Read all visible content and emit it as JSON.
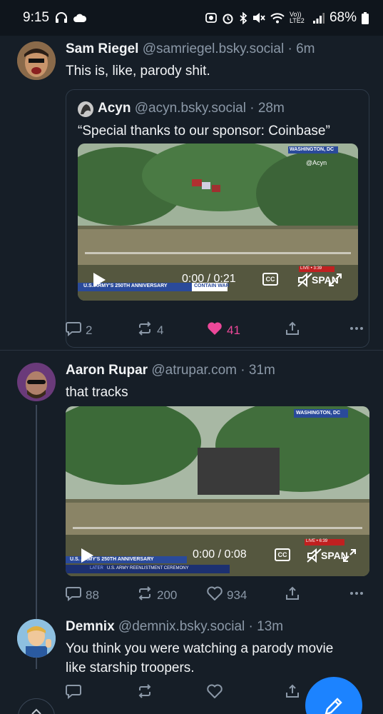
{
  "status_bar": {
    "time": "9:15",
    "network": "Vo)) LTE2",
    "battery": "68%"
  },
  "posts": [
    {
      "name": "Sam Riegel",
      "handle": "@samriegel.bsky.social",
      "time": "6m",
      "text": "This is, like, parody shit.",
      "quote": {
        "name": "Acyn",
        "handle": "@acyn.bsky.social",
        "time": "28m",
        "text": "“Special thanks to our sponsor: Coinbase”",
        "video": {
          "time": "0:00 / 0:21",
          "cc": "CC",
          "chyron": "U.S. ARMY'S 250TH ANNIVERSARY",
          "chyron_sub": "CONTAIN WAR",
          "location": "WASHINGTON, DC",
          "watermark": "@Acyn",
          "network": "SPAN",
          "live": "LIVE • 3:39"
        }
      },
      "replies": "2",
      "reposts": "4",
      "likes": "41"
    },
    {
      "name": "Aaron Rupar",
      "handle": "@atrupar.com",
      "time": "31m",
      "text": "that tracks",
      "video": {
        "time": "0:00 / 0:08",
        "cc": "CC",
        "chyron": "U.S. ARMY'S 250TH ANNIVERSARY",
        "chyron_later": "LATER",
        "chyron_sub": "U.S. ARMY REENLISTMENT CEREMONY",
        "location": "WASHINGTON, DC",
        "network": "SPAN",
        "live": "LIVE • 6:39"
      },
      "replies": "88",
      "reposts": "200",
      "likes": "934"
    },
    {
      "name": "Demnix",
      "handle": "@demnix.bsky.social",
      "time": "13m",
      "text_line1": "You think you were watching a parody movie",
      "text_line2": "like starship troopers."
    }
  ],
  "icons": {
    "reply": "reply-icon",
    "repost": "repost-icon",
    "like": "heart-icon",
    "share": "share-icon",
    "more": "more-icon",
    "compose": "compose-icon"
  },
  "colors": {
    "background": "#161e27",
    "like_active": "#ec4899",
    "fab": "#1c83ff"
  }
}
